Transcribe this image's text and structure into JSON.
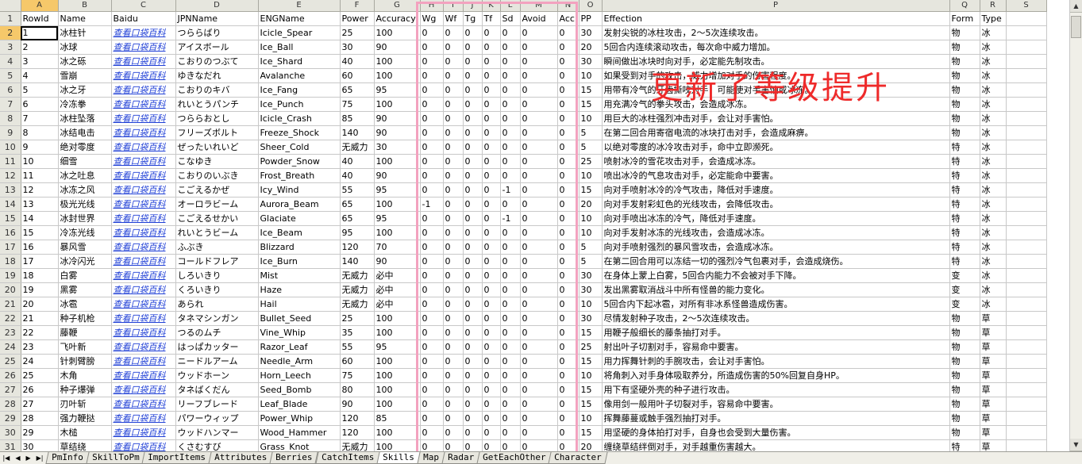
{
  "col_letters": [
    "A",
    "B",
    "C",
    "D",
    "E",
    "F",
    "G",
    "H",
    "I",
    "J",
    "K",
    "L",
    "M",
    "N",
    "O",
    "P",
    "Q",
    "R",
    "S"
  ],
  "headers": [
    "RowId",
    "Name",
    "Baidu",
    "JPNName",
    "ENGName",
    "Power",
    "Accuracy",
    "Wg",
    "Wf",
    "Tg",
    "Tf",
    "Sd",
    "Avoid",
    "Acc",
    "PP",
    "Effection",
    "Form",
    "Type",
    ""
  ],
  "rows": [
    [
      "1",
      "冰柱针",
      "查看口袋百科",
      "つららばり",
      "Icicle_Spear",
      "25",
      "100",
      "0",
      "0",
      "0",
      "0",
      "0",
      "0",
      "0",
      "30",
      "发射尖锐的冰柱攻击，2～5次连续攻击。",
      "物",
      "冰"
    ],
    [
      "2",
      "冰球",
      "查看口袋百科",
      "アイスボール",
      "Ice_Ball",
      "30",
      "90",
      "0",
      "0",
      "0",
      "0",
      "0",
      "0",
      "0",
      "20",
      "5回合内连续滚动攻击，每次命中威力增加。",
      "物",
      "冰"
    ],
    [
      "3",
      "冰之砾",
      "查看口袋百科",
      "こおりのつぶて",
      "Ice_Shard",
      "40",
      "100",
      "0",
      "0",
      "0",
      "0",
      "0",
      "0",
      "0",
      "30",
      "瞬间做出冰块时向对手，必定能先制攻击。",
      "物",
      "冰"
    ],
    [
      "4",
      "雪崩",
      "查看口袋百科",
      "ゆきなだれ",
      "Avalanche",
      "60",
      "100",
      "0",
      "0",
      "0",
      "0",
      "0",
      "0",
      "0",
      "10",
      "如果受到对手的攻击，威力增加对手的伤害程度。",
      "物",
      "冰"
    ],
    [
      "5",
      "冰之牙",
      "查看口袋百科",
      "こおりのキバ",
      "Ice_Fang",
      "65",
      "95",
      "0",
      "0",
      "0",
      "0",
      "0",
      "0",
      "0",
      "15",
      "用带有冷气的牙齿撕咬对手，可能使对手害怕或冰冻。",
      "物",
      "冰"
    ],
    [
      "6",
      "冷冻拳",
      "查看口袋百科",
      "れいとうパンチ",
      "Ice_Punch",
      "75",
      "100",
      "0",
      "0",
      "0",
      "0",
      "0",
      "0",
      "0",
      "15",
      "用充满冷气的拳头攻击，会造成冰冻。",
      "物",
      "冰"
    ],
    [
      "7",
      "冰柱坠落",
      "查看口袋百科",
      "つららおとし",
      "Icicle_Crash",
      "85",
      "90",
      "0",
      "0",
      "0",
      "0",
      "0",
      "0",
      "0",
      "10",
      "用巨大的冰柱强烈冲击对手，会让对手害怕。",
      "物",
      "冰"
    ],
    [
      "8",
      "冰结电击",
      "查看口袋百科",
      "フリーズボルト",
      "Freeze_Shock",
      "140",
      "90",
      "0",
      "0",
      "0",
      "0",
      "0",
      "0",
      "0",
      "5",
      "在第二回合用寄宿电流的冰块打击对手，会造成麻痹。",
      "物",
      "冰"
    ],
    [
      "9",
      "绝对零度",
      "查看口袋百科",
      "ぜったいれいど",
      "Sheer_Cold",
      "无威力",
      "30",
      "0",
      "0",
      "0",
      "0",
      "0",
      "0",
      "0",
      "5",
      "以绝对零度的冰冷攻击对手，命中立即濒死。",
      "特",
      "冰"
    ],
    [
      "10",
      "细雪",
      "查看口袋百科",
      "こなゆき",
      "Powder_Snow",
      "40",
      "100",
      "0",
      "0",
      "0",
      "0",
      "0",
      "0",
      "0",
      "25",
      "喷射冰冷的雪花攻击对手，会造成冰冻。",
      "特",
      "冰"
    ],
    [
      "11",
      "冰之吐息",
      "查看口袋百科",
      "こおりのいぶき",
      "Frost_Breath",
      "40",
      "90",
      "0",
      "0",
      "0",
      "0",
      "0",
      "0",
      "0",
      "10",
      "喷出冰冷的气息攻击对手，必定能命中要害。",
      "特",
      "冰"
    ],
    [
      "12",
      "冰冻之风",
      "查看口袋百科",
      "こごえるかぜ",
      "Icy_Wind",
      "55",
      "95",
      "0",
      "0",
      "0",
      "0",
      "-1",
      "0",
      "0",
      "15",
      "向对手喷射冰冷的冷气攻击，降低对手速度。",
      "特",
      "冰"
    ],
    [
      "13",
      "极光光线",
      "查看口袋百科",
      "オーロラビーム",
      "Aurora_Beam",
      "65",
      "100",
      "-1",
      "0",
      "0",
      "0",
      "0",
      "0",
      "0",
      "20",
      "向对手发射彩虹色的光线攻击，会降低攻击。",
      "特",
      "冰"
    ],
    [
      "14",
      "冰封世界",
      "查看口袋百科",
      "こごえるせかい",
      "Glaciate",
      "65",
      "95",
      "0",
      "0",
      "0",
      "0",
      "-1",
      "0",
      "0",
      "10",
      "向对手喷出冰冻的冷气，降低对手速度。",
      "特",
      "冰"
    ],
    [
      "15",
      "冷冻光线",
      "查看口袋百科",
      "れいとうビーム",
      "Ice_Beam",
      "95",
      "100",
      "0",
      "0",
      "0",
      "0",
      "0",
      "0",
      "0",
      "10",
      "向对手发射冰冻的光线攻击，会造成冰冻。",
      "特",
      "冰"
    ],
    [
      "16",
      "暴风雪",
      "查看口袋百科",
      "ふぶき",
      "Blizzard",
      "120",
      "70",
      "0",
      "0",
      "0",
      "0",
      "0",
      "0",
      "0",
      "5",
      "向对手喷射强烈的暴风雪攻击，会造成冰冻。",
      "特",
      "冰"
    ],
    [
      "17",
      "冰冷闪光",
      "查看口袋百科",
      "コールドフレア",
      "Ice_Burn",
      "140",
      "90",
      "0",
      "0",
      "0",
      "0",
      "0",
      "0",
      "0",
      "5",
      "在第二回合用可以冻结一切的强烈冷气包裹对手，会造成烧伤。",
      "特",
      "冰"
    ],
    [
      "18",
      "白雾",
      "查看口袋百科",
      "しろいきり",
      "Mist",
      "无威力",
      "必中",
      "0",
      "0",
      "0",
      "0",
      "0",
      "0",
      "0",
      "30",
      "在身体上蒙上白雾，5回合内能力不会被对手下降。",
      "变",
      "冰"
    ],
    [
      "19",
      "黑雾",
      "查看口袋百科",
      "くろいきり",
      "Haze",
      "无威力",
      "必中",
      "0",
      "0",
      "0",
      "0",
      "0",
      "0",
      "0",
      "30",
      "发出黑雾取消战斗中所有怪兽的能力变化。",
      "变",
      "冰"
    ],
    [
      "20",
      "冰雹",
      "查看口袋百科",
      "あられ",
      "Hail",
      "无威力",
      "必中",
      "0",
      "0",
      "0",
      "0",
      "0",
      "0",
      "0",
      "10",
      "5回合内下起冰雹，对所有非冰系怪兽造成伤害。",
      "变",
      "冰"
    ],
    [
      "21",
      "种子机枪",
      "查看口袋百科",
      "タネマシンガン",
      "Bullet_Seed",
      "25",
      "100",
      "0",
      "0",
      "0",
      "0",
      "0",
      "0",
      "0",
      "30",
      "尽情发射种子攻击，2～5次连续攻击。",
      "物",
      "草"
    ],
    [
      "22",
      "藤鞭",
      "查看口袋百科",
      "つるのムチ",
      "Vine_Whip",
      "35",
      "100",
      "0",
      "0",
      "0",
      "0",
      "0",
      "0",
      "0",
      "15",
      "用鞭子般细长的藤条抽打对手。",
      "物",
      "草"
    ],
    [
      "23",
      "飞叶新",
      "查看口袋百科",
      "はっぱカッター",
      "Razor_Leaf",
      "55",
      "95",
      "0",
      "0",
      "0",
      "0",
      "0",
      "0",
      "0",
      "25",
      "射出叶子切割对手，容易命中要害。",
      "物",
      "草"
    ],
    [
      "24",
      "针刺臂膀",
      "查看口袋百科",
      "ニードルアーム",
      "Needle_Arm",
      "60",
      "100",
      "0",
      "0",
      "0",
      "0",
      "0",
      "0",
      "0",
      "15",
      "用力挥舞针刺的手腕攻击，会让对手害怕。",
      "物",
      "草"
    ],
    [
      "25",
      "木角",
      "查看口袋百科",
      "ウッドホーン",
      "Horn_Leech",
      "75",
      "100",
      "0",
      "0",
      "0",
      "0",
      "0",
      "0",
      "0",
      "10",
      "将角刺入对手身体吸取养分，所造成伤害的50%回复自身HP。",
      "物",
      "草"
    ],
    [
      "26",
      "种子爆弹",
      "查看口袋百科",
      "タネばくだん",
      "Seed_Bomb",
      "80",
      "100",
      "0",
      "0",
      "0",
      "0",
      "0",
      "0",
      "0",
      "15",
      "用下有坚硬外壳的种子进行攻击。",
      "物",
      "草"
    ],
    [
      "27",
      "刃叶斩",
      "查看口袋百科",
      "リーフブレード",
      "Leaf_Blade",
      "90",
      "100",
      "0",
      "0",
      "0",
      "0",
      "0",
      "0",
      "0",
      "15",
      "像用剑一般用叶子切裂对手，容易命中要害。",
      "物",
      "草"
    ],
    [
      "28",
      "强力鞭挞",
      "查看口袋百科",
      "パワーウィップ",
      "Power_Whip",
      "120",
      "85",
      "0",
      "0",
      "0",
      "0",
      "0",
      "0",
      "0",
      "10",
      "挥舞藤蔓或触手强烈抽打对手。",
      "物",
      "草"
    ],
    [
      "29",
      "木槌",
      "查看口袋百科",
      "ウッドハンマー",
      "Wood_Hammer",
      "120",
      "100",
      "0",
      "0",
      "0",
      "0",
      "0",
      "0",
      "0",
      "15",
      "用坚硬的身体拍打对手，自身也会受到大量伤害。",
      "物",
      "草"
    ],
    [
      "30",
      "草结绕",
      "查看口袋百科",
      "くさむすび",
      "Grass_Knot",
      "无威力",
      "100",
      "0",
      "0",
      "0",
      "0",
      "0",
      "0",
      "0",
      "20",
      "缠绕草结绊倒对手，对手越重伤害越大。",
      "特",
      "草"
    ]
  ],
  "tabs": [
    "PmInfo",
    "SkillToPm",
    "ImportItems",
    "Attributes",
    "Berries",
    "CatchItems",
    "Skills",
    "Map",
    "Radar",
    "GetEachOther",
    "Character"
  ],
  "active_tab": "Skills",
  "annotation": "更新了等级提升",
  "tab_nav_icons": [
    "first-sheet-icon",
    "prev-sheet-icon",
    "next-sheet-icon",
    "last-sheet-icon"
  ]
}
